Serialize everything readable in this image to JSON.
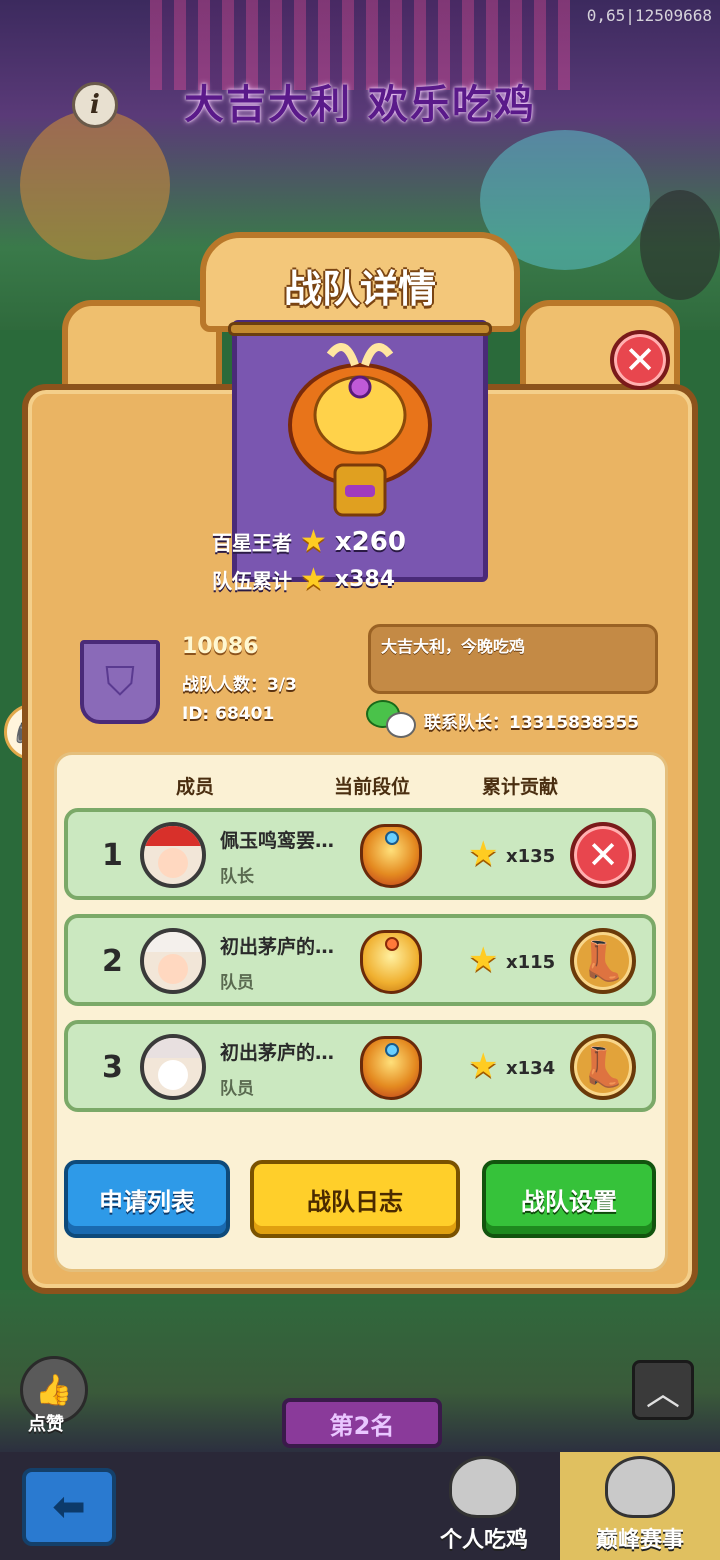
{
  "header": {
    "coords_readout": "0,65|12509668",
    "banner_title": "大吉大利 欢乐吃鸡"
  },
  "panel": {
    "title": "战队详情",
    "stats": {
      "king_label": "百星王者",
      "king_value": "x260",
      "total_label": "队伍累计",
      "total_value": "x384"
    },
    "team": {
      "name": "10086",
      "members_text": "战队人数：3/3",
      "id_text": "ID: 68401",
      "motto": "大吉大利，今晚吃鸡",
      "contact_text": "联系队长：13315838355"
    },
    "columns": {
      "member": "成员",
      "tier": "当前段位",
      "contribution": "累计贡献"
    },
    "members": [
      {
        "rank": "1",
        "name": "佩玉鸣鸾罢…",
        "role": "队长",
        "contribution": "x135",
        "action_icon": "close-icon"
      },
      {
        "rank": "2",
        "name": "初出茅庐的…",
        "role": "队员",
        "contribution": "x115",
        "action_icon": "boot-icon"
      },
      {
        "rank": "3",
        "name": "初出茅庐的…",
        "role": "队员",
        "contribution": "x134",
        "action_icon": "boot-icon"
      }
    ],
    "buttons": {
      "apply_list": "申请列表",
      "team_log": "战队日志",
      "team_settings": "战队设置"
    }
  },
  "background": {
    "like_label": "点赞",
    "rank_plate": "第2名"
  },
  "bottom_nav": {
    "tabs": [
      {
        "label": "个人吃鸡"
      },
      {
        "label": "巅峰赛事"
      }
    ]
  },
  "colors": {
    "panel_bg": "#eab463",
    "panel_border": "#8c531c",
    "row_bg": "#cbe8c0",
    "button_blue": "#2e9ae8",
    "button_yellow": "#ffcf2a",
    "button_green": "#36c23a",
    "close_red": "#e8464e"
  }
}
